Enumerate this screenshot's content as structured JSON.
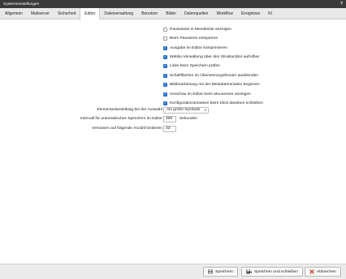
{
  "window": {
    "title": "Systemeinstellungen",
    "help_label": "?"
  },
  "tabs": [
    {
      "label": "Allgemein"
    },
    {
      "label": "Mailserver"
    },
    {
      "label": "Sicherheit"
    },
    {
      "label": "Editor",
      "active": true
    },
    {
      "label": "Dateiverwaltung"
    },
    {
      "label": "Benutzer"
    },
    {
      "label": "Bilder"
    },
    {
      "label": "Datenquellen"
    },
    {
      "label": "Workflow"
    },
    {
      "label": "Ereignisse"
    },
    {
      "label": "KI"
    }
  ],
  "options": [
    {
      "label": "Pausetaste in Menüleiste anzeigen",
      "checked": false
    },
    {
      "label": "Beim Pausieren entsperren",
      "checked": false
    },
    {
      "label": "Ausgabe im Editor komprimieren",
      "checked": true
    },
    {
      "label": "Weblio-Verwaltung über den Strukturditor aufrufbar",
      "checked": true
    },
    {
      "label": "Links beim Speichern prüfen",
      "checked": true
    },
    {
      "label": "Schaltflächen im Übersetzungsfenster ausblenden",
      "checked": true
    },
    {
      "label": "Bildbearbeitung mit der Metadatenmaske beginnen",
      "checked": true
    },
    {
      "label": "Vorschau im Editor beim Mouseover anzeigen",
      "checked": true
    },
    {
      "label": "Konfigurationsmasken beim Klick daneben schließen",
      "checked": true
    }
  ],
  "element_display": {
    "label": "Elementedarstellung bei der Auswahl",
    "value": "Als große Symbole"
  },
  "autosave": {
    "label": "Intervall für automatisches Speichern im Editor",
    "value": "300",
    "unit": "Sekunden"
  },
  "versions": {
    "label": "Versionen auf folgende Anzahl limitieren",
    "value": "33"
  },
  "footer": {
    "save_label": "Speichern",
    "save_close_label": "Speichern und schließen",
    "cancel_label": "Abbrechen"
  },
  "colors": {
    "checkbox_on": "#2f78d3",
    "titlebar": "#3a3a3a",
    "cancel_icon": "#c9302c"
  }
}
